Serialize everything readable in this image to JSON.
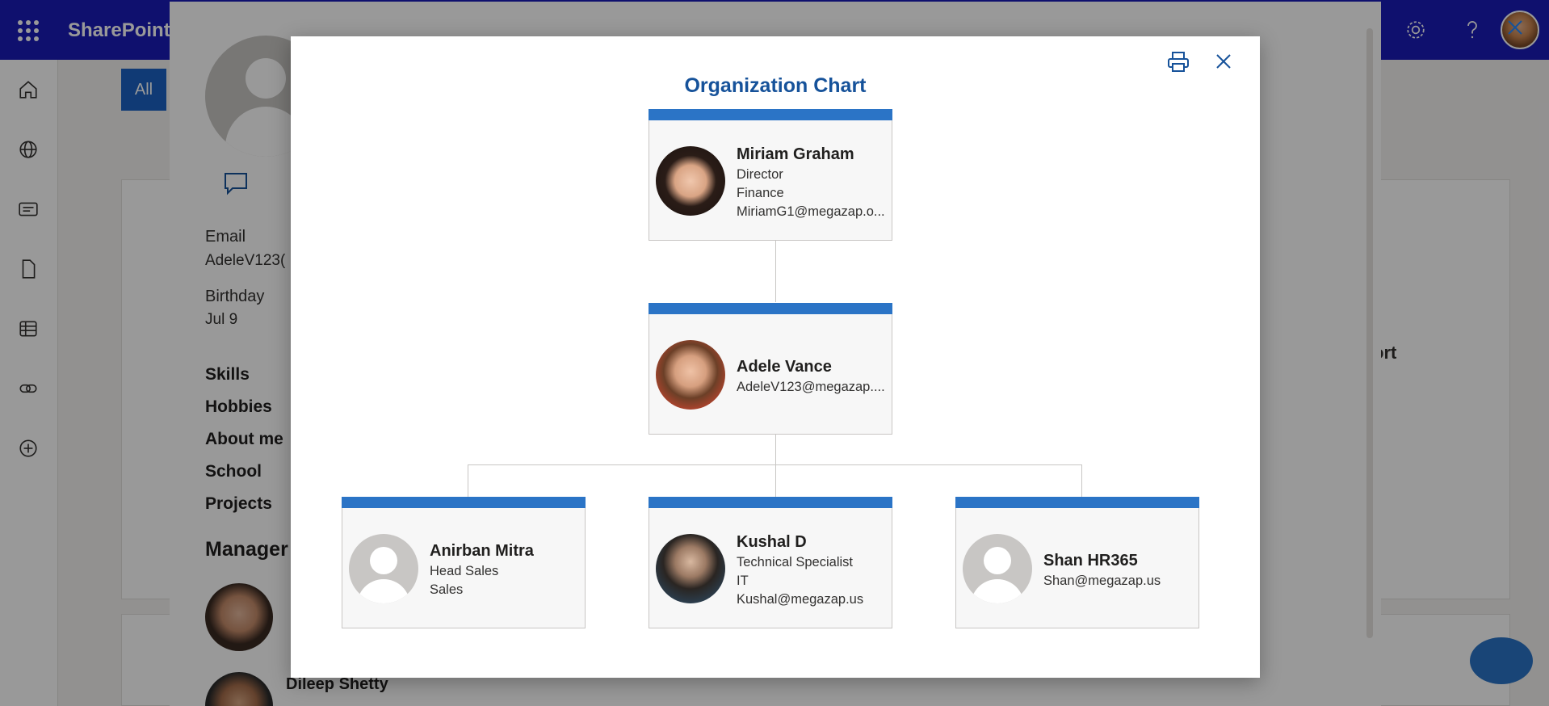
{
  "app": {
    "brand": "SharePoint"
  },
  "suitebar": {
    "icons": [
      "app-launcher-icon",
      "settings-icon",
      "help-icon",
      "avatar"
    ]
  },
  "background": {
    "tab_all": "All",
    "right_fragment": "ort"
  },
  "profile": {
    "email_label": "Email",
    "email_value": "AdeleV123(",
    "birthday_label": "Birthday",
    "birthday_value": "Jul 9",
    "links": [
      "Skills",
      "Hobbies",
      "About me",
      "School",
      "Projects"
    ],
    "manager_heading": "Manager",
    "second_manager_name": "Dileep Shetty"
  },
  "modal": {
    "title": "Organization Chart",
    "print_icon": "print-icon",
    "close_icon": "close-icon"
  },
  "org": {
    "top": {
      "name": "Miriam Graham",
      "lines": [
        "Director",
        "Finance",
        "MiriamG1@megazap.o..."
      ]
    },
    "middle": {
      "name": "Adele Vance",
      "lines": [
        "AdeleV123@megazap...."
      ]
    },
    "reports": [
      {
        "name": "Anirban Mitra",
        "lines": [
          "Head Sales",
          "Sales"
        ]
      },
      {
        "name": "Kushal D",
        "lines": [
          "Technical Specialist",
          "IT",
          "Kushal@megazap.us"
        ]
      },
      {
        "name": "Shan HR365",
        "lines": [
          "Shan@megazap.us"
        ]
      }
    ]
  },
  "colors": {
    "suitebar": "#1a1bb8",
    "node_bar": "#2b74c6",
    "title": "#16529a"
  }
}
